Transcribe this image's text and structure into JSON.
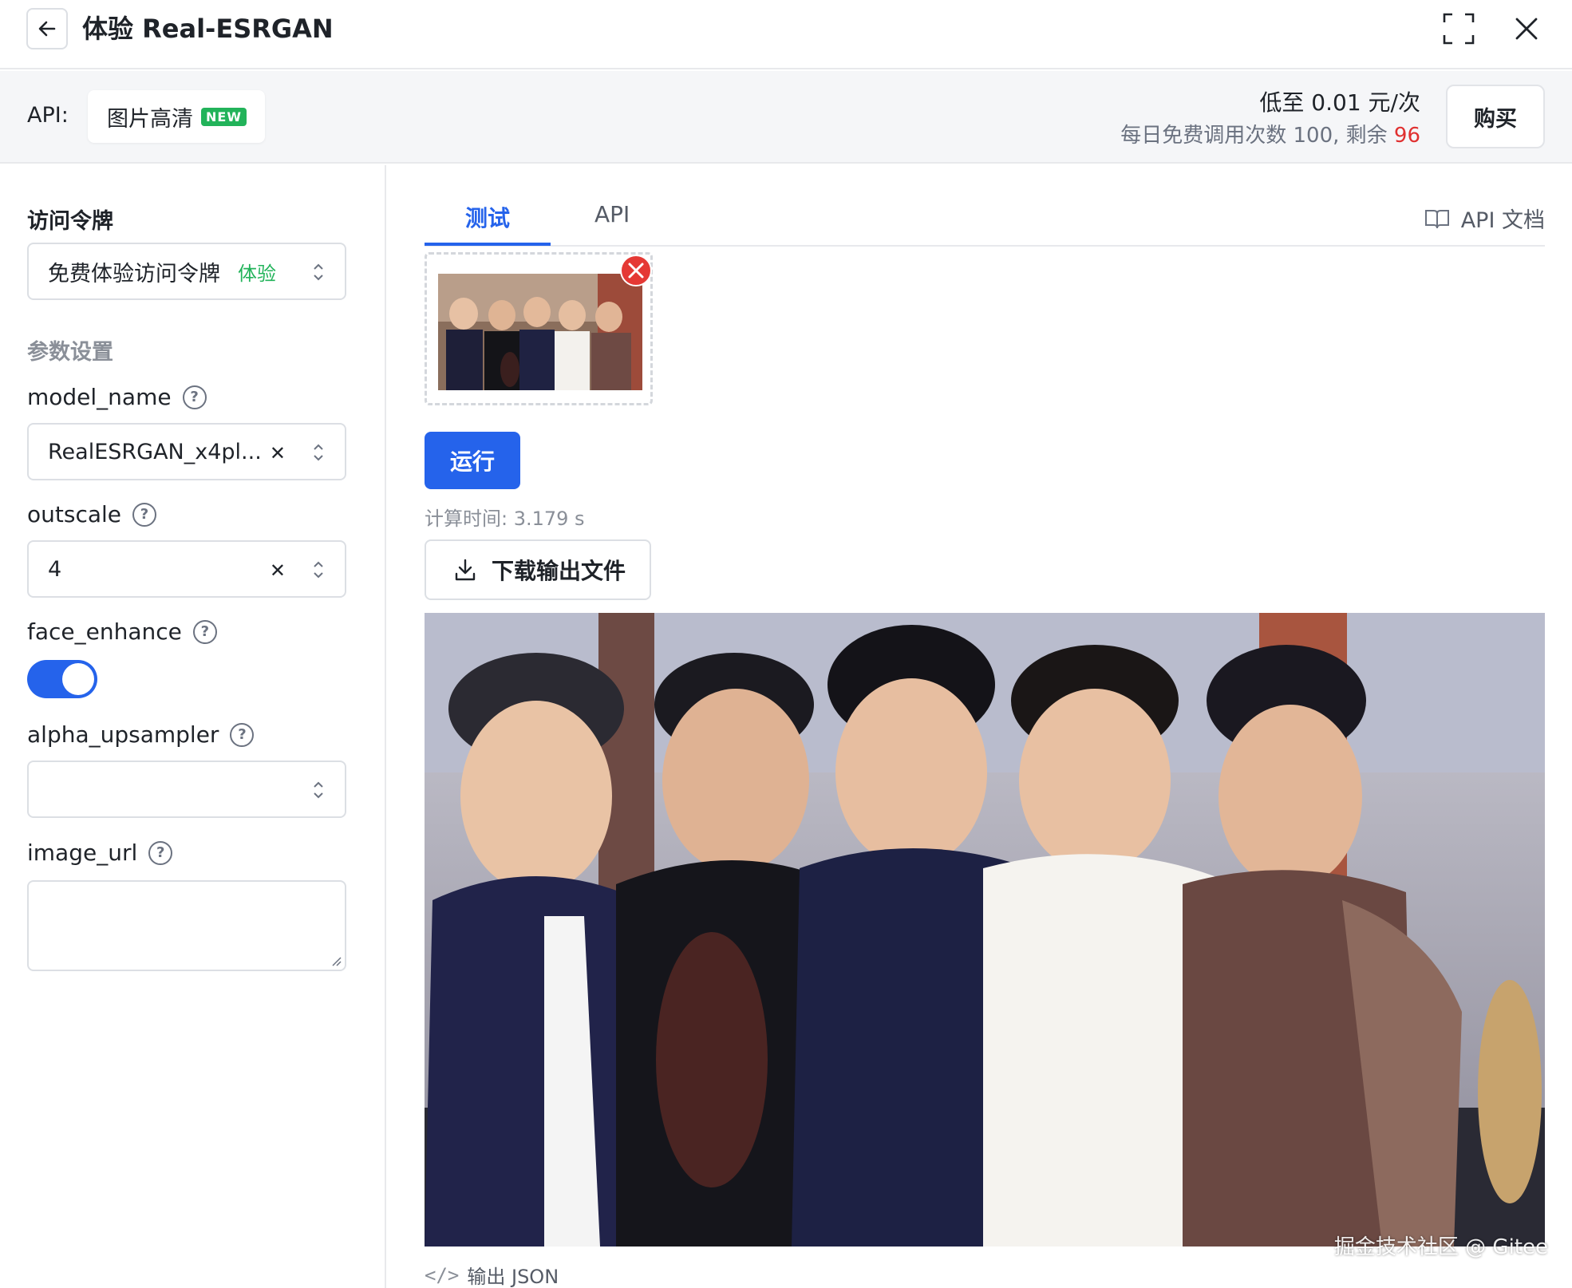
{
  "header": {
    "title": "体验  Real-ESRGAN"
  },
  "api_bar": {
    "label": "API:",
    "chip_label": "图片高清",
    "chip_badge": "NEW",
    "price": "低至 0.01 元/次",
    "quota_prefix": "每日免费调用次数 100, 剩余 ",
    "quota_remaining": "96",
    "buy_label": "购买"
  },
  "left": {
    "token_heading": "访问令牌",
    "token_value": "免费体验访问令牌",
    "token_tag": "体验",
    "params_heading": "参数设置",
    "model_name": {
      "label": "model_name",
      "value": "RealESRGAN_x4pl..."
    },
    "outscale": {
      "label": "outscale",
      "value": "4"
    },
    "face_enhance": {
      "label": "face_enhance",
      "on": true
    },
    "alpha_upsampler": {
      "label": "alpha_upsampler",
      "value": ""
    },
    "image_url": {
      "label": "image_url",
      "value": ""
    }
  },
  "right": {
    "tabs": [
      {
        "label": "测试",
        "active": true
      },
      {
        "label": "API",
        "active": false
      }
    ],
    "doc_link": "API 文档",
    "run_label": "运行",
    "calc_time": "计算时间: 3.179 s",
    "download_label": "下载输出文件",
    "json_link": "输出 JSON",
    "watermark": "掘金技术社区 @ Gitee"
  },
  "icons": {
    "back": "arrow-left-icon",
    "fullscreen": "fullscreen-icon",
    "close": "close-icon",
    "help": "question-circle-icon",
    "clear": "clear-icon",
    "updown": "chevron-updown-icon",
    "book": "book-icon",
    "remove": "remove-circle-icon",
    "download": "download-icon",
    "code": "code-icon"
  },
  "colors": {
    "accent": "#2563eb",
    "badge_green": "#22b35a",
    "remaining_red": "#e03030"
  }
}
